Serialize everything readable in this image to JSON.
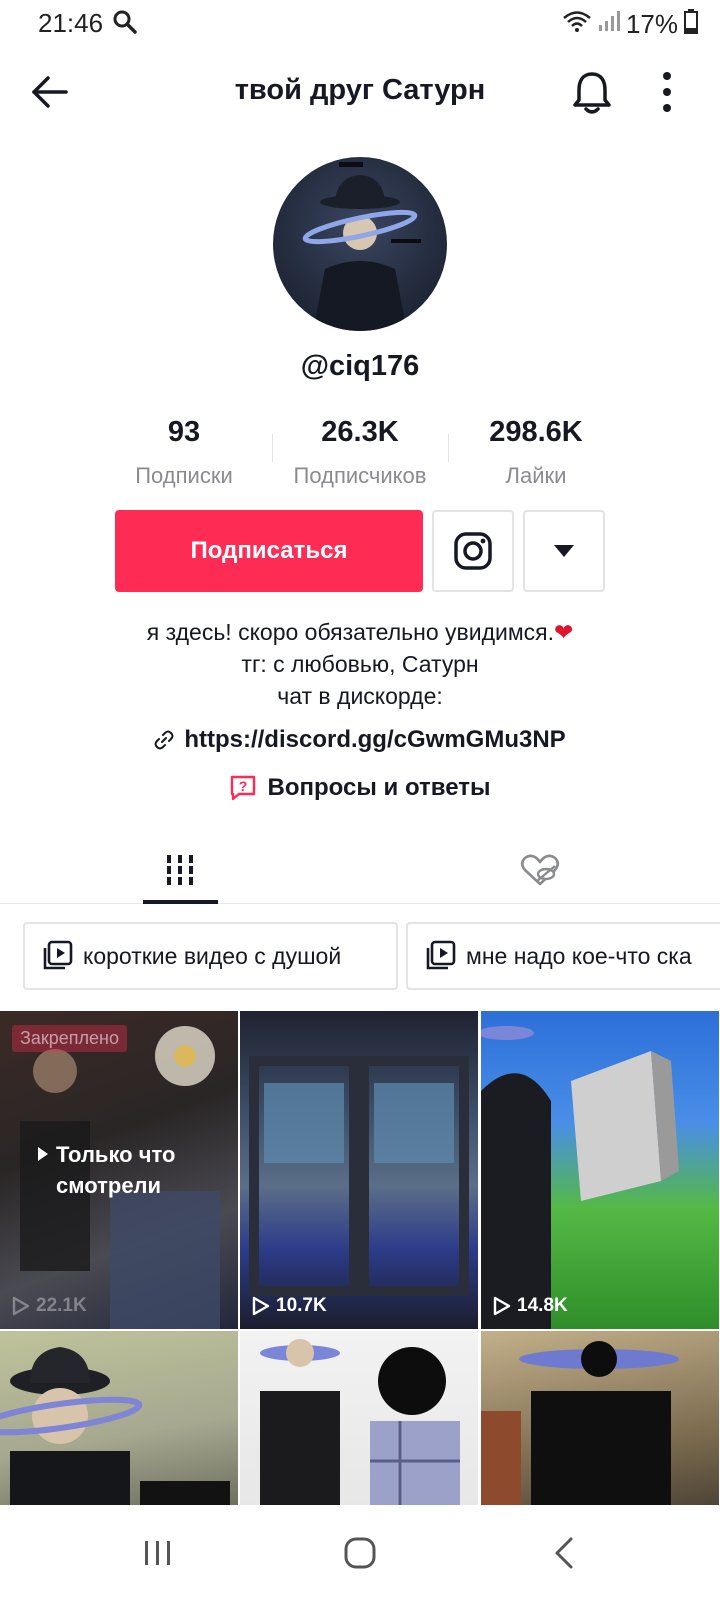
{
  "status_bar": {
    "time": "21:46",
    "battery": "17%"
  },
  "header": {
    "title": "твой друг Сатурн"
  },
  "profile": {
    "username": "@ciq176",
    "stats": [
      {
        "value": "93",
        "label": "Подписки"
      },
      {
        "value": "26.3K",
        "label": "Подписчиков"
      },
      {
        "value": "298.6K",
        "label": "Лайки"
      }
    ],
    "follow_label": "Подписаться",
    "bio": [
      "я здесь! скоро обязательно увидимся.",
      "тг: с любовью, Сатурн",
      "чат в дискорде:"
    ],
    "link": "https://discord.gg/cGwmGMu3NP",
    "qa_label": "Вопросы и ответы"
  },
  "playlists": [
    {
      "title": "короткие видео с душой"
    },
    {
      "title": "мне надо кое-что ска"
    }
  ],
  "videos": [
    {
      "views": "22.1K",
      "pinned_label": "Закреплено",
      "overlay": "Только что смотрели"
    },
    {
      "views": "10.7K"
    },
    {
      "views": "14.8K"
    },
    {},
    {},
    {}
  ],
  "colors": {
    "accent": "#fe2c55",
    "text": "#161823",
    "muted": "#8a8b91"
  }
}
